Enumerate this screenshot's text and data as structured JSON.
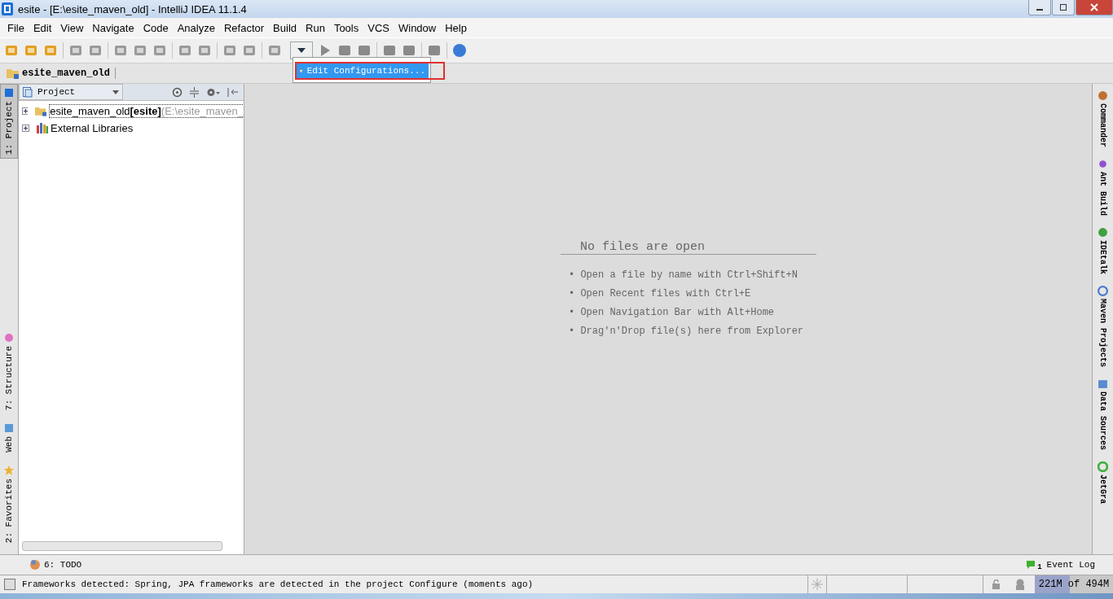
{
  "window": {
    "title": "esite - [E:\\esite_maven_old] - IntelliJ IDEA 11.1.4"
  },
  "menu": [
    "File",
    "Edit",
    "View",
    "Navigate",
    "Code",
    "Analyze",
    "Refactor",
    "Build",
    "Run",
    "Tools",
    "VCS",
    "Window",
    "Help"
  ],
  "run_popup": {
    "items": [
      {
        "label": "Edit Configurations...",
        "selected": true
      }
    ]
  },
  "breadcrumb": {
    "label": "esite_maven_old"
  },
  "left_strip": [
    {
      "label": "1: Project",
      "selected": true
    },
    {
      "label": "7: Structure",
      "selected": false
    },
    {
      "label": "Web",
      "selected": false
    },
    {
      "label": "2: Favorites",
      "selected": false
    }
  ],
  "project_panel": {
    "view": "Project",
    "tree": [
      {
        "kind": "module",
        "label": "esite_maven_old",
        "module": "[esite]",
        "path": "(E:\\esite_maven_",
        "expanded": false
      },
      {
        "kind": "libraries",
        "label": "External Libraries",
        "expanded": false
      }
    ]
  },
  "editor": {
    "heading": "No files are open",
    "hints": [
      "• Open a file by name with Ctrl+Shift+N",
      "• Open Recent files with Ctrl+E",
      "• Open Navigation Bar with Alt+Home",
      "• Drag'n'Drop file(s) here from Explorer"
    ]
  },
  "right_strip": [
    {
      "label": "Commander"
    },
    {
      "label": "Ant Build"
    },
    {
      "label": "IDEtalk"
    },
    {
      "label": "Maven Projects"
    },
    {
      "label": "Data Sources"
    },
    {
      "label": "JetGra"
    }
  ],
  "bottom_tools": {
    "todo": "6: TODO",
    "event_log": "Event Log",
    "event_count": "1"
  },
  "status_bar": {
    "message": "Frameworks detected: Spring, JPA frameworks are detected in the project Configure (moments ago)",
    "memory": {
      "text": "221M of 494M",
      "level": 0.447
    }
  }
}
